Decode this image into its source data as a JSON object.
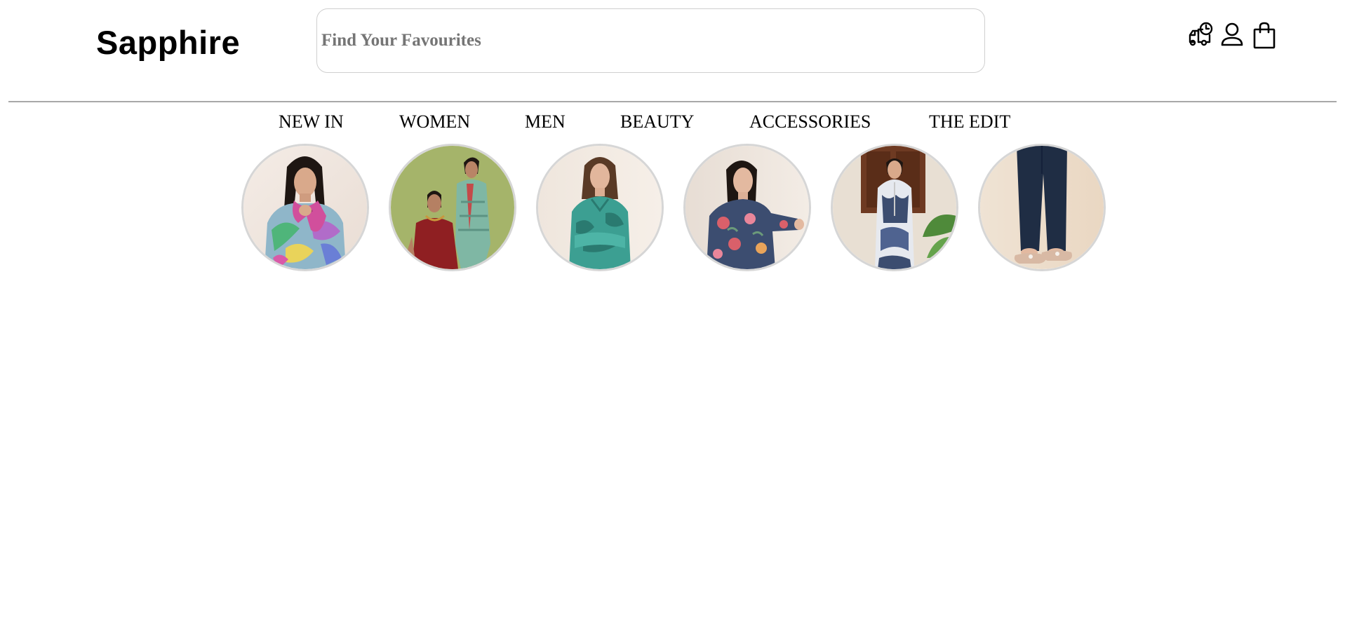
{
  "brand": {
    "name": "Sapphire"
  },
  "search": {
    "placeholder": "Find Your Favourites"
  },
  "header_icons": [
    "delivery-truck-icon",
    "user-icon",
    "shopping-bag-icon"
  ],
  "nav": {
    "items": [
      {
        "label": "NEW IN"
      },
      {
        "label": "WOMEN"
      },
      {
        "label": "MEN"
      },
      {
        "label": "BEAUTY"
      },
      {
        "label": "ACCESSORIES"
      },
      {
        "label": "THE EDIT"
      }
    ]
  },
  "colors": {
    "text": "#000000",
    "placeholder": "#757575",
    "border": "#cfcfcf",
    "divider": "#a8a8a8",
    "circle_border": "#d6d6d6"
  }
}
